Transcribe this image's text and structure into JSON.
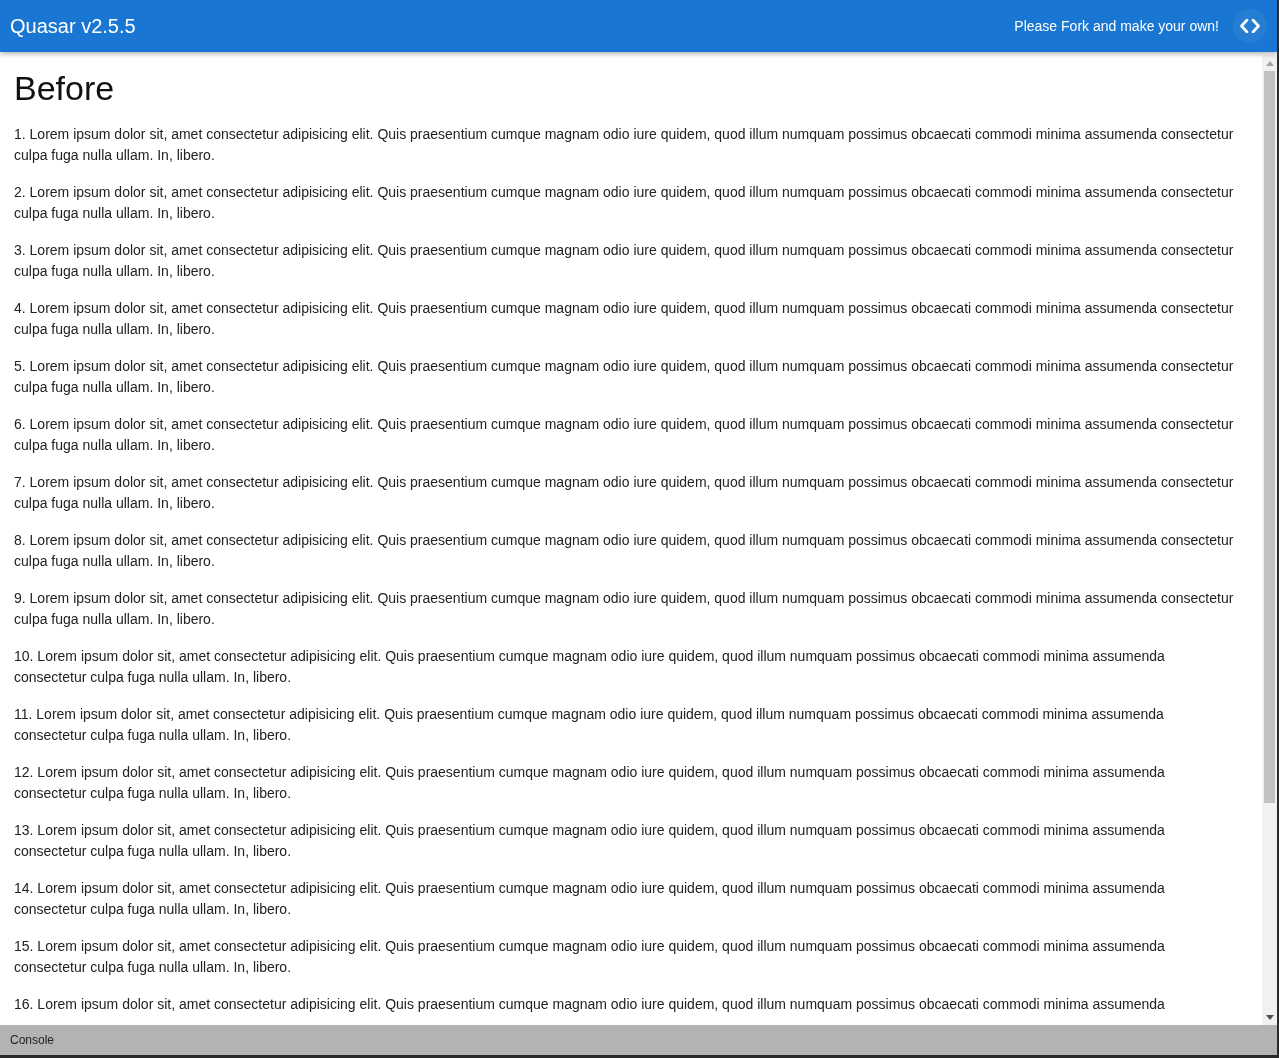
{
  "header": {
    "title": "Quasar v2.5.5",
    "message": "Please Fork and make your own!"
  },
  "page": {
    "heading": "Before",
    "paragraphs": [
      "1. Lorem ipsum dolor sit, amet consectetur adipisicing elit. Quis praesentium cumque magnam odio iure quidem, quod illum numquam possimus obcaecati commodi minima assumenda consectetur culpa fuga nulla ullam. In, libero.",
      "2. Lorem ipsum dolor sit, amet consectetur adipisicing elit. Quis praesentium cumque magnam odio iure quidem, quod illum numquam possimus obcaecati commodi minima assumenda consectetur culpa fuga nulla ullam. In, libero.",
      "3. Lorem ipsum dolor sit, amet consectetur adipisicing elit. Quis praesentium cumque magnam odio iure quidem, quod illum numquam possimus obcaecati commodi minima assumenda consectetur culpa fuga nulla ullam. In, libero.",
      "4. Lorem ipsum dolor sit, amet consectetur adipisicing elit. Quis praesentium cumque magnam odio iure quidem, quod illum numquam possimus obcaecati commodi minima assumenda consectetur culpa fuga nulla ullam. In, libero.",
      "5. Lorem ipsum dolor sit, amet consectetur adipisicing elit. Quis praesentium cumque magnam odio iure quidem, quod illum numquam possimus obcaecati commodi minima assumenda consectetur culpa fuga nulla ullam. In, libero.",
      "6. Lorem ipsum dolor sit, amet consectetur adipisicing elit. Quis praesentium cumque magnam odio iure quidem, quod illum numquam possimus obcaecati commodi minima assumenda consectetur culpa fuga nulla ullam. In, libero.",
      "7. Lorem ipsum dolor sit, amet consectetur adipisicing elit. Quis praesentium cumque magnam odio iure quidem, quod illum numquam possimus obcaecati commodi minima assumenda consectetur culpa fuga nulla ullam. In, libero.",
      "8. Lorem ipsum dolor sit, amet consectetur adipisicing elit. Quis praesentium cumque magnam odio iure quidem, quod illum numquam possimus obcaecati commodi minima assumenda consectetur culpa fuga nulla ullam. In, libero.",
      "9. Lorem ipsum dolor sit, amet consectetur adipisicing elit. Quis praesentium cumque magnam odio iure quidem, quod illum numquam possimus obcaecati commodi minima assumenda consectetur culpa fuga nulla ullam. In, libero.",
      "10. Lorem ipsum dolor sit, amet consectetur adipisicing elit. Quis praesentium cumque magnam odio iure quidem, quod illum numquam possimus obcaecati commodi minima assumenda consectetur culpa fuga nulla ullam. In, libero.",
      "11. Lorem ipsum dolor sit, amet consectetur adipisicing elit. Quis praesentium cumque magnam odio iure quidem, quod illum numquam possimus obcaecati commodi minima assumenda consectetur culpa fuga nulla ullam. In, libero.",
      "12. Lorem ipsum dolor sit, amet consectetur adipisicing elit. Quis praesentium cumque magnam odio iure quidem, quod illum numquam possimus obcaecati commodi minima assumenda consectetur culpa fuga nulla ullam. In, libero.",
      "13. Lorem ipsum dolor sit, amet consectetur adipisicing elit. Quis praesentium cumque magnam odio iure quidem, quod illum numquam possimus obcaecati commodi minima assumenda consectetur culpa fuga nulla ullam. In, libero.",
      "14. Lorem ipsum dolor sit, amet consectetur adipisicing elit. Quis praesentium cumque magnam odio iure quidem, quod illum numquam possimus obcaecati commodi minima assumenda consectetur culpa fuga nulla ullam. In, libero.",
      "15. Lorem ipsum dolor sit, amet consectetur adipisicing elit. Quis praesentium cumque magnam odio iure quidem, quod illum numquam possimus obcaecati commodi minima assumenda consectetur culpa fuga nulla ullam. In, libero.",
      "16. Lorem ipsum dolor sit, amet consectetur adipisicing elit. Quis praesentium cumque magnam odio iure quidem, quod illum numquam possimus obcaecati commodi minima assumenda"
    ]
  },
  "console_bar": {
    "label": "Console"
  }
}
